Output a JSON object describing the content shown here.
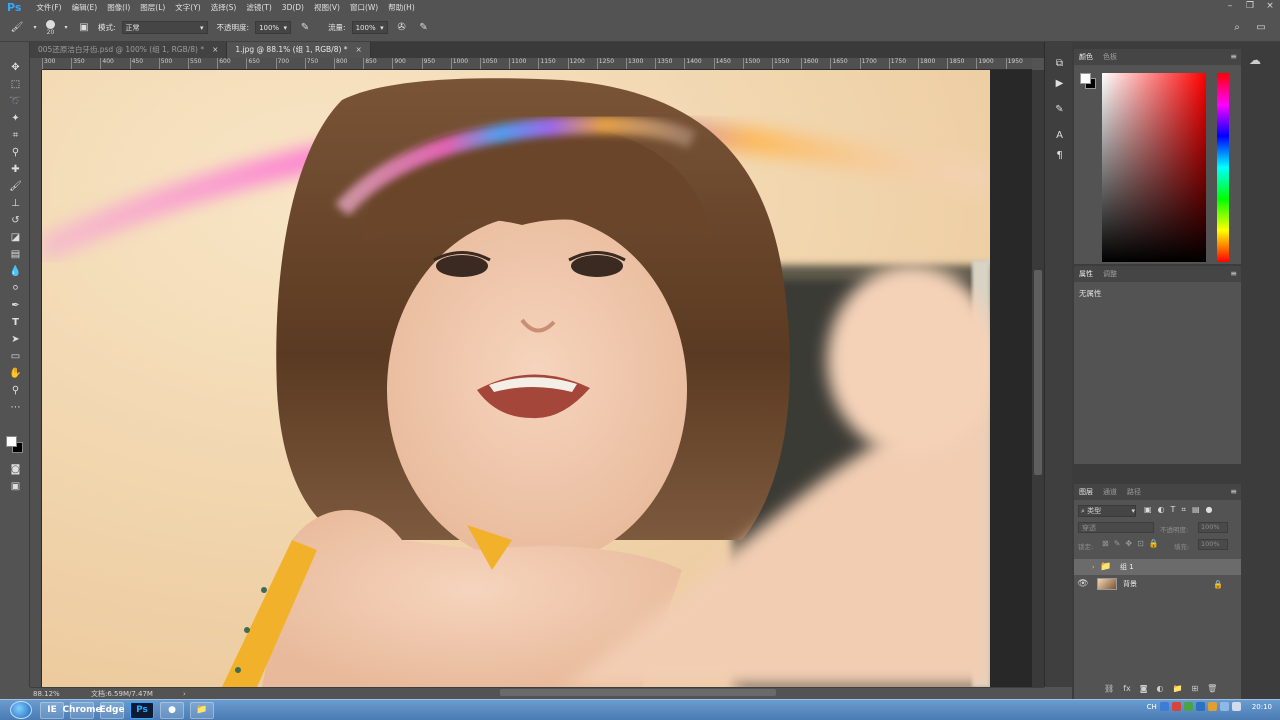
{
  "app": {
    "logo": "Ps"
  },
  "menu": [
    "文件(F)",
    "编辑(E)",
    "图像(I)",
    "图层(L)",
    "文字(Y)",
    "选择(S)",
    "滤镜(T)",
    "3D(D)",
    "视图(V)",
    "窗口(W)",
    "帮助(H)"
  ],
  "options": {
    "brush_size": "20",
    "mode_label": "模式:",
    "mode_value": "正常",
    "opacity_label": "不透明度:",
    "opacity_value": "100%",
    "flow_label": "流量:",
    "flow_value": "100%"
  },
  "tabs": [
    {
      "label": "005还原洁白牙齿.psd @ 100% (组 1, RGB/8) *",
      "close": "×"
    },
    {
      "label": "1.jpg @ 88.1% (组 1, RGB/8) *",
      "close": "×"
    }
  ],
  "ruler_top": [
    "300",
    "350",
    "400",
    "450",
    "500",
    "550",
    "600",
    "650",
    "700",
    "750",
    "800",
    "850",
    "900",
    "950",
    "1000",
    "1050",
    "1100",
    "1150",
    "1200",
    "1250",
    "1300",
    "1350",
    "1400",
    "1450",
    "1500",
    "1550",
    "1600",
    "1650",
    "1700",
    "1750",
    "1800",
    "1850",
    "1900",
    "1950"
  ],
  "status": {
    "zoom": "88.12%",
    "doc": "文档:6.59M/7.47M",
    "arrow": "›"
  },
  "panels": {
    "color": {
      "tabs": [
        "颜色",
        "色板"
      ],
      "colors": {
        "fg": "#ffffff",
        "bg": "#000000"
      }
    },
    "properties": {
      "tabs": [
        "属性",
        "调整"
      ],
      "content": "无属性"
    },
    "layers": {
      "tabs": [
        "图层",
        "通道",
        "路径"
      ],
      "filter_label": "类型",
      "blend": "穿透",
      "opacity_label": "不透明度:",
      "opacity_value": "100%",
      "lock_label": "锁定:",
      "fill_label": "填充:",
      "fill_value": "100%",
      "items": [
        {
          "name": "组 1",
          "type": "group",
          "visible": false
        },
        {
          "name": "背景",
          "type": "image",
          "visible": true
        }
      ]
    }
  },
  "taskbar": {
    "apps": [
      "IE",
      "Chrome",
      "Edge",
      "Ps",
      "●",
      "📁"
    ],
    "tray_lang": "CH",
    "time": "20:10"
  }
}
